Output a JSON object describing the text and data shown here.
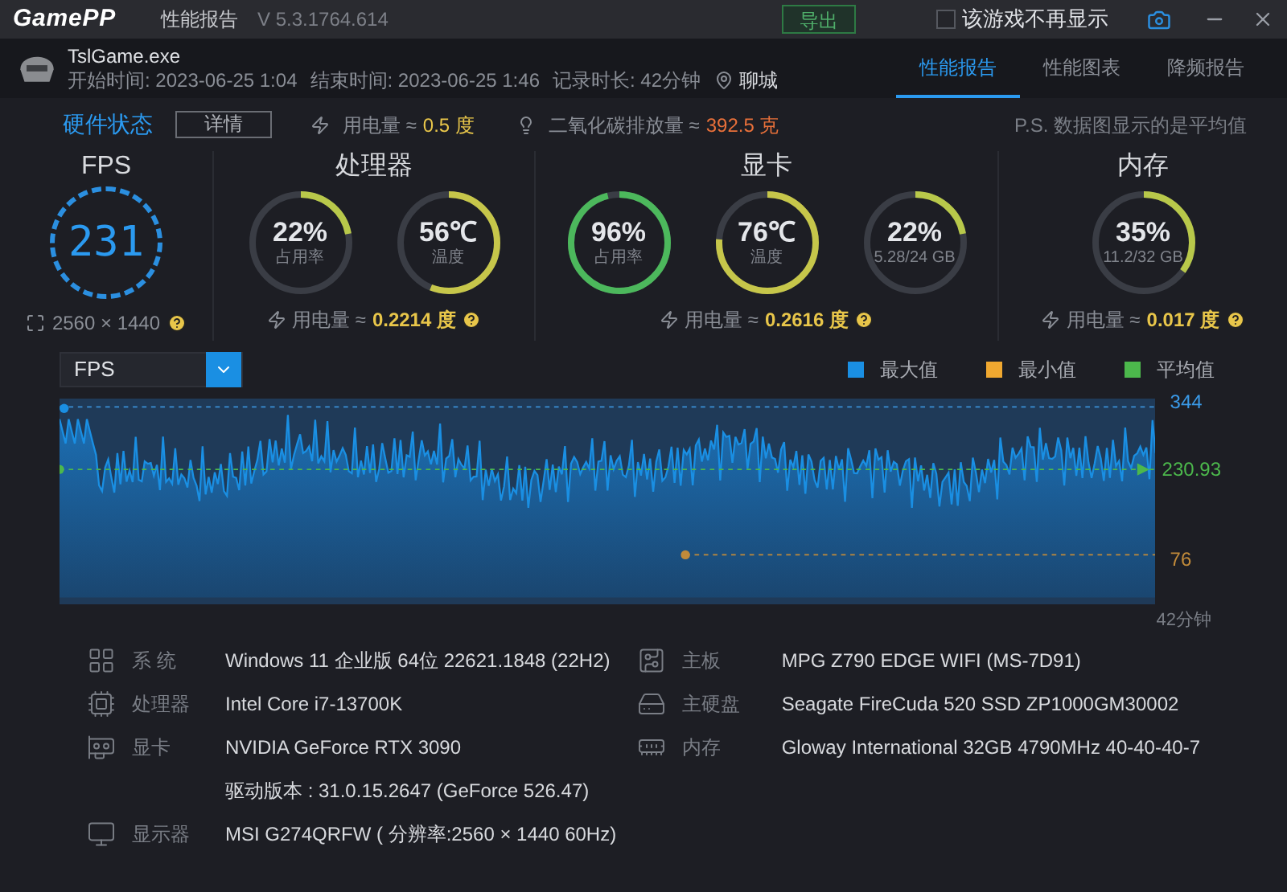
{
  "app": {
    "logo": "GamePP",
    "title": "性能报告",
    "version": "V 5.3.1764.614",
    "export_button": "导出",
    "hide_checkbox": {
      "label": "该游戏不再显示",
      "checked": false
    }
  },
  "game": {
    "name": "TslGame.exe",
    "start": "开始时间: 2023-06-25 1:04",
    "end": "结束时间: 2023-06-25 1:46",
    "duration": "记录时长: 42分钟",
    "location": "聊城"
  },
  "tabs": [
    {
      "label": "性能报告",
      "selected": true
    },
    {
      "label": "性能图表",
      "selected": false
    },
    {
      "label": "降频报告",
      "selected": false
    }
  ],
  "hardware_status": {
    "title": "硬件状态",
    "details_button": "详情",
    "power_label": "用电量 ≈",
    "power_value": "0.5 度",
    "co2_label": "二氧化碳排放量 ≈",
    "co2_value": "392.5 克",
    "note": "P.S. 数据图显示的是平均值"
  },
  "fps": {
    "title": "FPS",
    "value": "231",
    "resolution": "2560 × 1440"
  },
  "sections": [
    {
      "title": "处理器",
      "power_label": "用电量 ≈",
      "power_value": "0.2214 度",
      "gauges": [
        {
          "value": "22%",
          "caption": "占用率"
        },
        {
          "value": "56℃",
          "caption": "温度"
        }
      ]
    },
    {
      "title": "显卡",
      "power_label": "用电量 ≈",
      "power_value": "0.2616 度",
      "gauges": [
        {
          "value": "96%",
          "caption": "占用率"
        },
        {
          "value": "76℃",
          "caption": "温度"
        },
        {
          "value": "22%",
          "caption": "5.28/24 GB"
        }
      ]
    },
    {
      "title": "内存",
      "power_label": "用电量 ≈",
      "power_value": "0.017 度",
      "gauges": [
        {
          "value": "35%",
          "caption": "11.2/32 GB"
        }
      ]
    }
  ],
  "chart": {
    "metric": "FPS",
    "legend": [
      {
        "label": "最大值",
        "color": "#1a8fe3"
      },
      {
        "label": "最小值",
        "color": "#f0a830"
      },
      {
        "label": "平均值",
        "color": "#4cb84c"
      }
    ],
    "max_label": "344",
    "avg_label": "230.93",
    "min_label": "76",
    "x_label": "42分钟"
  },
  "specs_left": [
    {
      "kind": "os",
      "label": "系 统",
      "values": [
        "Windows 11 企业版 64位 22621.1848 (22H2)"
      ]
    },
    {
      "kind": "cpu",
      "label": "处理器",
      "values": [
        "Intel Core i7-13700K"
      ]
    },
    {
      "kind": "gpu",
      "label": "显卡",
      "values": [
        "NVIDIA GeForce RTX 3090",
        "驱动版本 : 31.0.15.2647 (GeForce 526.47)"
      ]
    },
    {
      "kind": "monitor",
      "label": "显示器",
      "values": [
        "MSI G274QRFW ( 分辨率:2560 × 1440 60Hz)"
      ]
    }
  ],
  "specs_right": [
    {
      "kind": "board",
      "label": "主板",
      "values": [
        "MPG Z790 EDGE WIFI (MS-7D91)"
      ]
    },
    {
      "kind": "disk",
      "label": "主硬盘",
      "values": [
        "Seagate FireCuda 520 SSD ZP1000GM30002"
      ]
    },
    {
      "kind": "memory",
      "label": "内存",
      "values": [
        "Gloway International 32GB 4790MHz 40-40-40-7"
      ]
    }
  ]
}
